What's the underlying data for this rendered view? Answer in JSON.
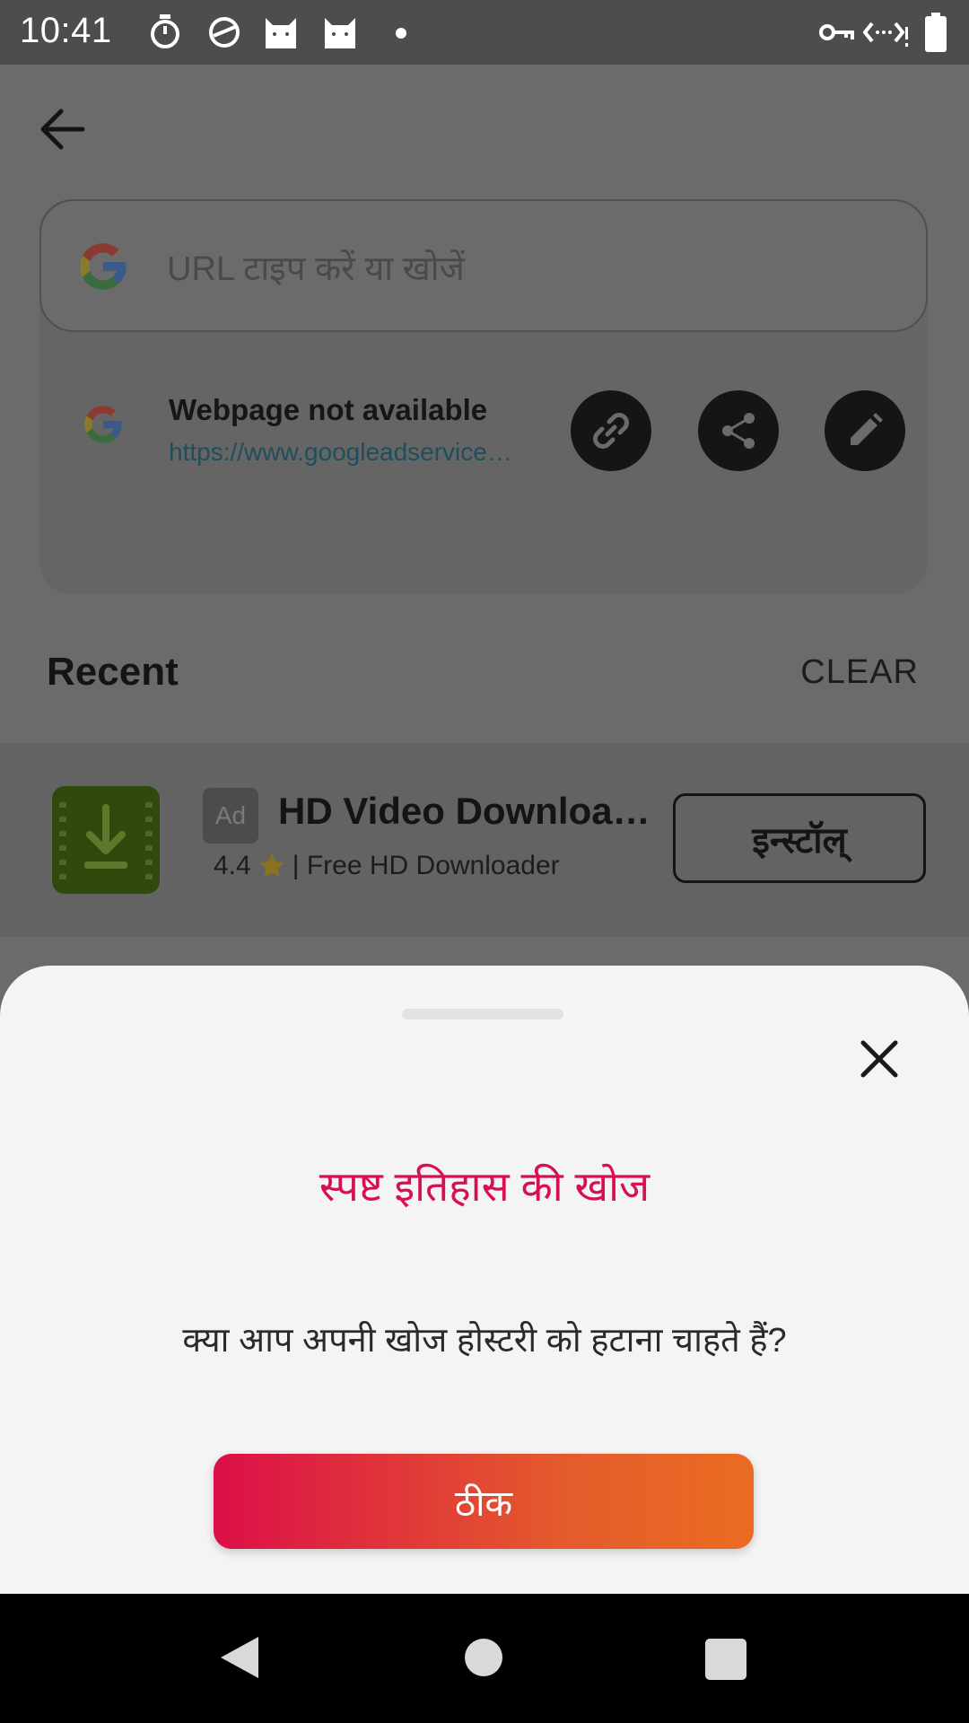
{
  "status_bar": {
    "time": "10:41",
    "left_icons": [
      "stopwatch-icon",
      "sync-icon",
      "cat-icon",
      "cat-icon",
      "dot-icon"
    ],
    "right_icons": [
      "vpn-key-icon",
      "data-icon",
      "battery-icon"
    ]
  },
  "header": {
    "back_icon": "arrow-left-icon"
  },
  "search": {
    "placeholder": "URL टाइप करें या खोजें",
    "logo": "google-logo"
  },
  "suggestion": {
    "title": "Webpage not available",
    "url": "https://www.googleadservice…",
    "actions": [
      "link-icon",
      "share-icon",
      "edit-icon"
    ]
  },
  "recent": {
    "title": "Recent",
    "clear_label": "CLEAR"
  },
  "ad": {
    "badge": "Ad",
    "title": "HD Video Downloa…",
    "rating": "4.4",
    "subtitle": "| Free HD Downloader",
    "install_label": "इन्स्टॉल्"
  },
  "dialog": {
    "title": "स्पष्ट इतिहास की खोज",
    "message": "क्या आप अपनी खोज होस्टरी को हटाना चाहते हैं?",
    "ok_label": "ठीक",
    "colors": {
      "title": "#d8104f",
      "button_start": "#dc0f48",
      "button_end": "#ea6c22"
    }
  },
  "nav_bar": {
    "items": [
      "back-triangle-icon",
      "home-circle-icon",
      "recents-square-icon"
    ]
  }
}
